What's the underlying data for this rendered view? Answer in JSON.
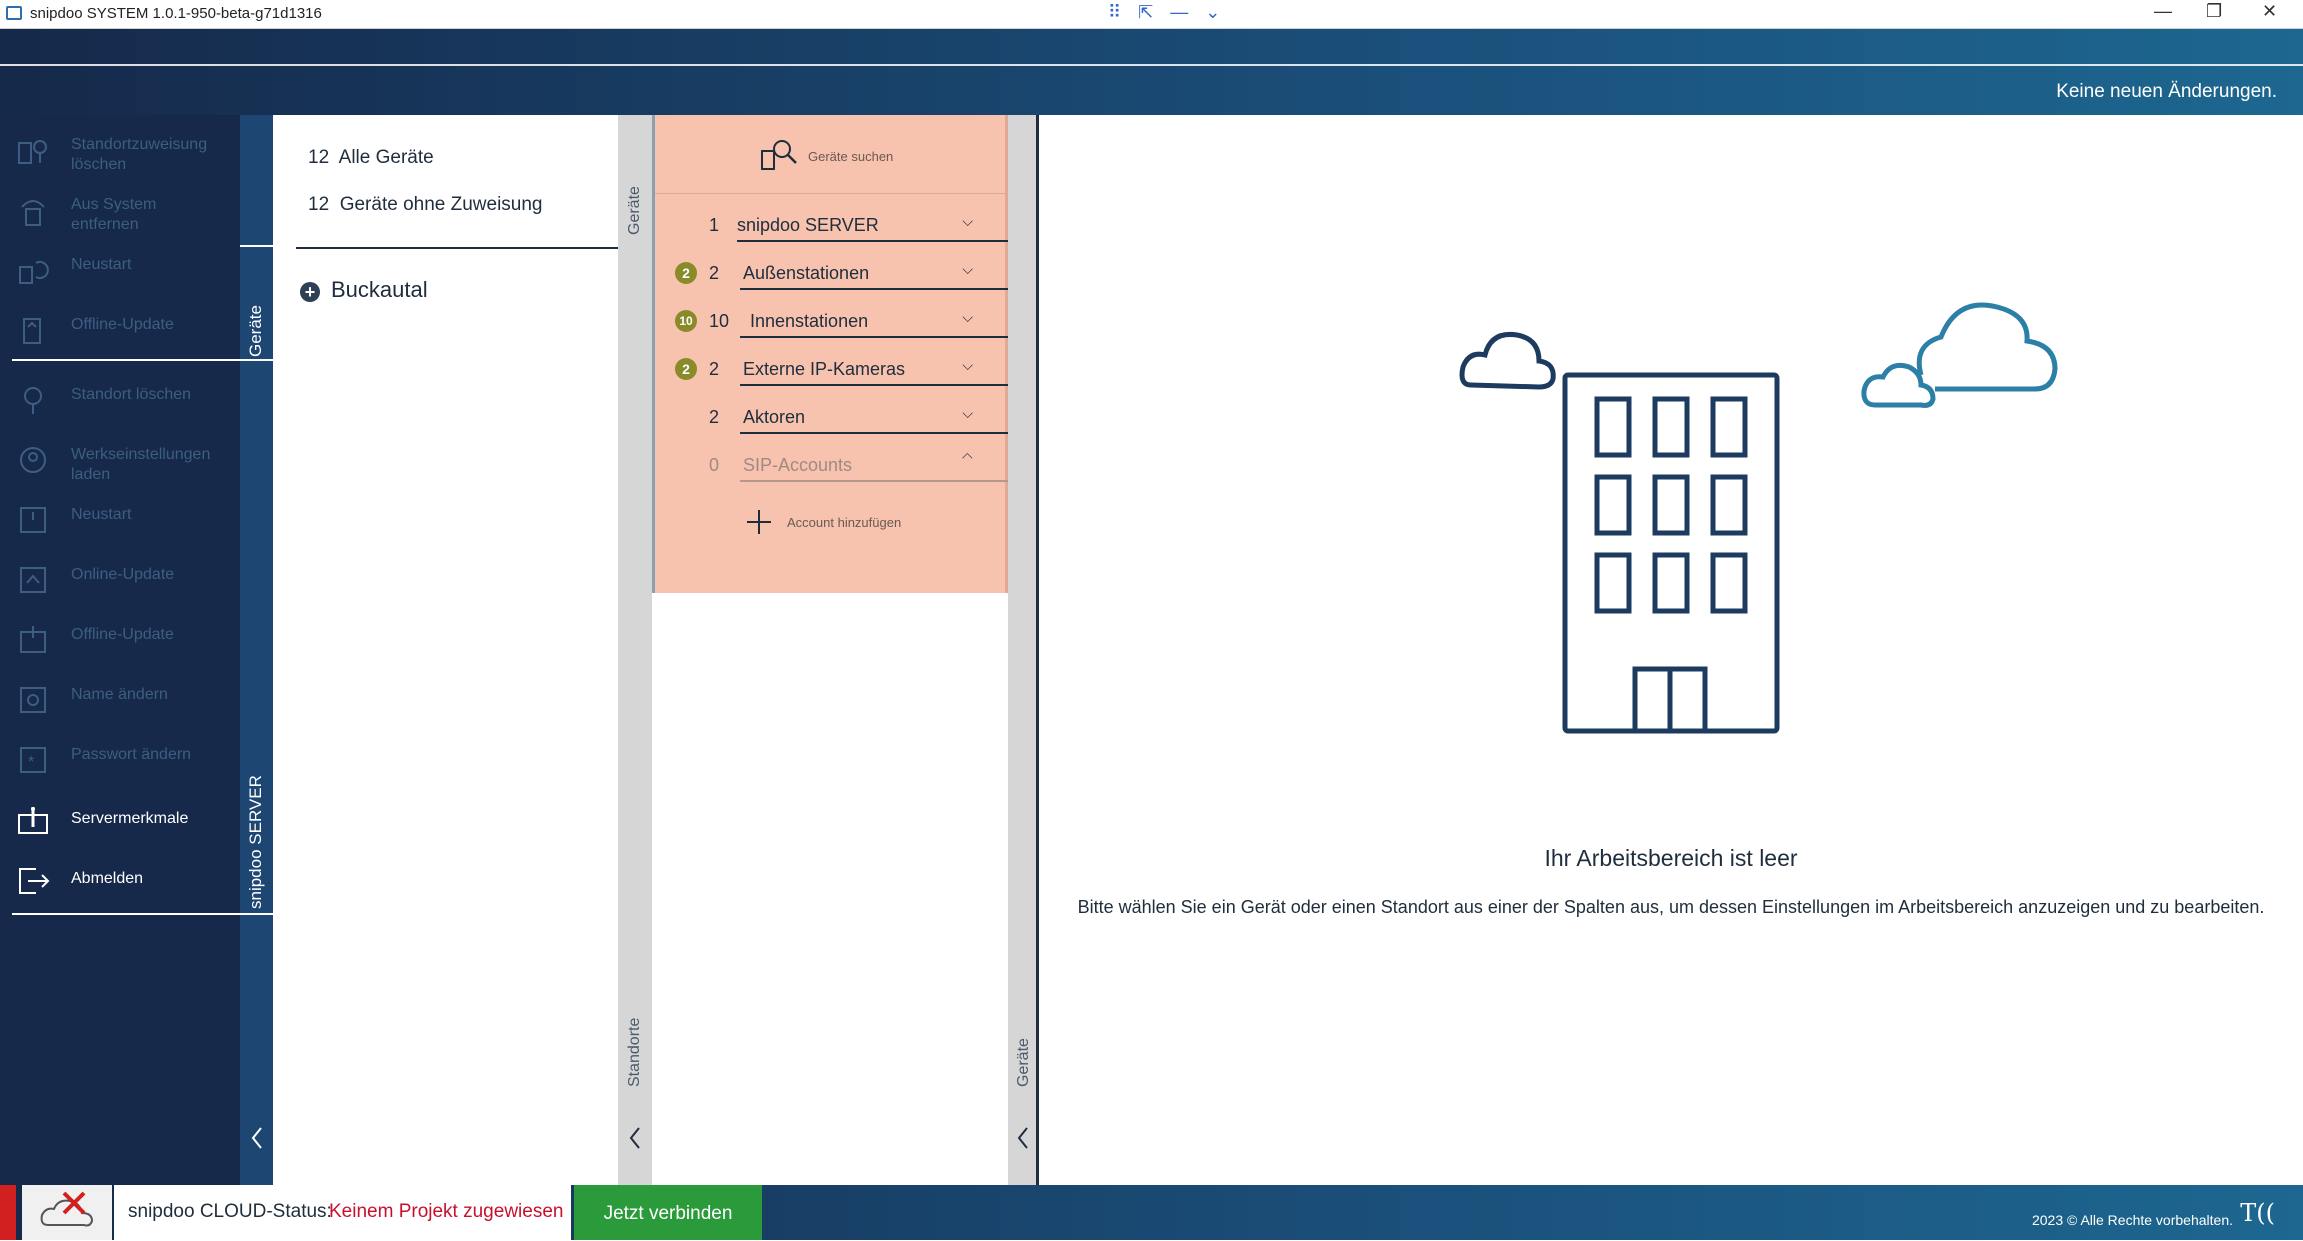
{
  "window": {
    "title": "snipdoo SYSTEM 1.0.1-950-beta-g71d1316",
    "controls": {
      "minimize": "—",
      "restore": "❐",
      "close": "✕"
    }
  },
  "header": {
    "status": "Keine neuen Änderungen."
  },
  "sidebar": {
    "device_section_label": "Geräte",
    "server_section_label": "snipdoo SERVER",
    "device_items": [
      {
        "label": "Standortzuweisung löschen",
        "icon": "location-remove-icon"
      },
      {
        "label": "Aus System entfernen",
        "icon": "remove-device-icon"
      },
      {
        "label": "Neustart",
        "icon": "restart-icon"
      },
      {
        "label": "Offline-Update",
        "icon": "offline-update-icon"
      }
    ],
    "server_items": [
      {
        "label": "Standort löschen",
        "icon": "location-delete-icon"
      },
      {
        "label": "Werkseinstellungen laden",
        "icon": "factory-reset-icon"
      },
      {
        "label": "Neustart",
        "icon": "power-icon"
      },
      {
        "label": "Online-Update",
        "icon": "online-update-icon"
      },
      {
        "label": "Offline-Update",
        "icon": "offline-update-icon"
      },
      {
        "label": "Name ändern",
        "icon": "settings-icon"
      },
      {
        "label": "Passwort ändern",
        "icon": "password-icon"
      },
      {
        "label": "Servermerkmale",
        "icon": "server-info-icon"
      },
      {
        "label": "Abmelden",
        "icon": "logout-icon"
      }
    ],
    "collapse_icon": "chevron-left-icon"
  },
  "locations": {
    "summary": [
      {
        "count": "12",
        "label": "Alle Geräte"
      },
      {
        "count": "12",
        "label": "Geräte ohne Zuweisung"
      }
    ],
    "items": [
      {
        "label": "Buckautal"
      }
    ],
    "strip_label": "Standorte",
    "strip_top_label": "Geräte"
  },
  "devices": {
    "search_label": "Geräte suchen",
    "groups": [
      {
        "badge": "",
        "count": "1",
        "label": "snipdoo SERVER",
        "expanded": false
      },
      {
        "badge": "2",
        "count": "2",
        "label": "Außenstationen",
        "expanded": false
      },
      {
        "badge": "10",
        "count": "10",
        "label": "Innenstationen",
        "expanded": false
      },
      {
        "badge": "2",
        "count": "2",
        "label": "Externe IP-Kameras",
        "expanded": false
      },
      {
        "badge": "",
        "count": "2",
        "label": "Aktoren",
        "expanded": false
      },
      {
        "badge": "",
        "count": "0",
        "label": "SIP-Accounts",
        "expanded": true
      }
    ],
    "add_account_label": "Account hinzufügen",
    "strip_label": "Geräte"
  },
  "workspace": {
    "title": "Ihr Arbeitsbereich ist leer",
    "message": "Bitte wählen Sie ein Gerät oder einen Standort aus einer der Spalten aus, um dessen Einstellungen im Arbeitsbereich anzuzeigen und zu bearbeiten."
  },
  "footer": {
    "cloud_label": "snipdoo CLOUD-Status:",
    "cloud_status": "Keinem Projekt zugewiesen",
    "connect_label": "Jetzt verbinden",
    "copyright": "2023 © Alle Rechte vorbehalten.",
    "logo": "TCS"
  },
  "colors": {
    "navy": "#16294a",
    "header_blue": "#1d6790",
    "device_panel": "#f7c2ae",
    "badge_olive": "#8a8a2a",
    "status_red": "#c8102e",
    "connect_green": "#2a9a3a"
  }
}
